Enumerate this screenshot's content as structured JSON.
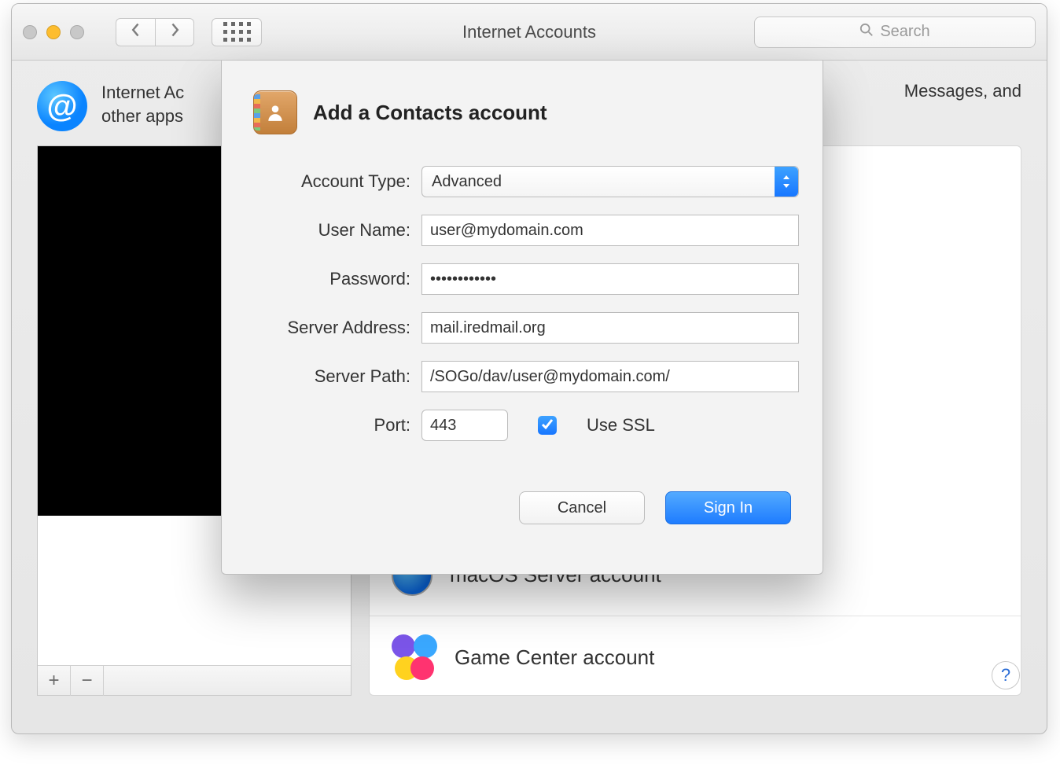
{
  "window": {
    "title": "Internet Accounts",
    "search_placeholder": "Search",
    "intro_line1": "Internet Ac",
    "intro_line2": "other apps",
    "intro_visible_right": "Messages, and"
  },
  "sidebar": {
    "add_label": "+",
    "remove_label": "−"
  },
  "providers": [
    {
      "icon": "globe",
      "label": "macOS Server account"
    },
    {
      "icon": "gamecenter",
      "label": "Game Center account"
    }
  ],
  "help_label": "?",
  "sheet": {
    "title": "Add a Contacts account",
    "fields": {
      "account_type_label": "Account Type:",
      "account_type_value": "Advanced",
      "username_label": "User Name:",
      "username_value": "user@mydomain.com",
      "password_label": "Password:",
      "password_value": "••••••••••••",
      "server_address_label": "Server Address:",
      "server_address_value": "mail.iredmail.org",
      "server_path_label": "Server Path:",
      "server_path_value": "/SOGo/dav/user@mydomain.com/",
      "port_label": "Port:",
      "port_value": "443",
      "use_ssl_label": "Use SSL",
      "use_ssl_checked": true
    },
    "buttons": {
      "cancel": "Cancel",
      "signin": "Sign In"
    }
  }
}
